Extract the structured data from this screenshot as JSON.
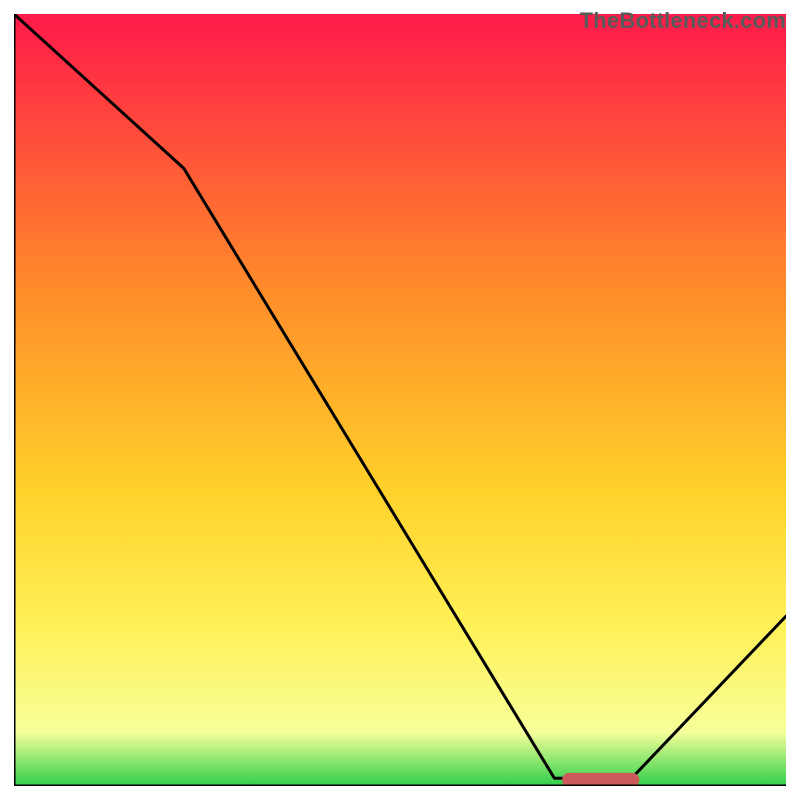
{
  "watermark": "TheBottleneck.com",
  "colors": {
    "gradient_top": "#ff1a4a",
    "gradient_mid_upper": "#ff8a2a",
    "gradient_mid": "#ffd22a",
    "gradient_mid_lower": "#fff25a",
    "gradient_low": "#f7ff9a",
    "gradient_bottom": "#2ecf4a",
    "curve": "#000000",
    "marker": "#cc5a5a",
    "axis": "#000000"
  },
  "chart_data": {
    "type": "line",
    "title": "",
    "xlabel": "",
    "ylabel": "",
    "xlim": [
      0,
      100
    ],
    "ylim": [
      0,
      100
    ],
    "x": [
      0,
      22,
      70,
      80,
      100
    ],
    "values": [
      100,
      80,
      1,
      1,
      22
    ],
    "marker": {
      "x_center": 76,
      "x_half_width": 5,
      "y": 0.8
    },
    "annotations": [],
    "legend": []
  }
}
